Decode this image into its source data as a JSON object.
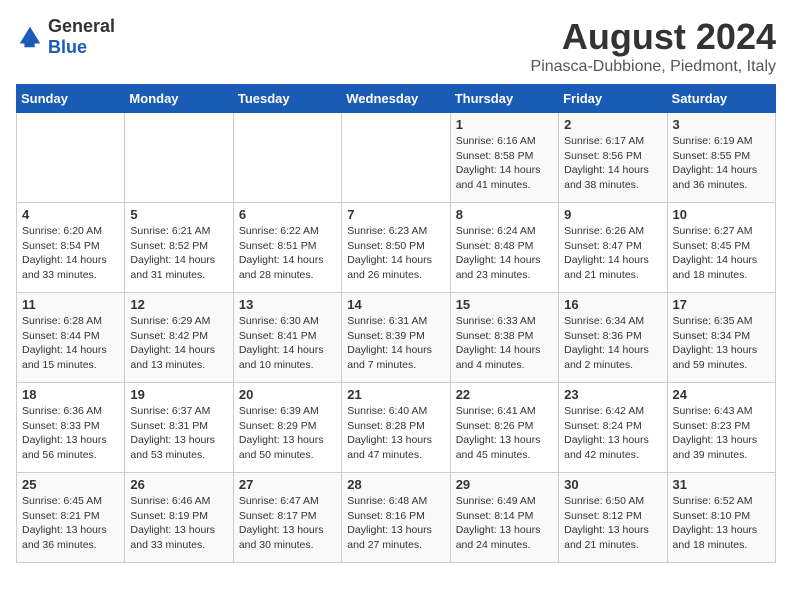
{
  "logo": {
    "general": "General",
    "blue": "Blue"
  },
  "title": "August 2024",
  "subtitle": "Pinasca-Dubbione, Piedmont, Italy",
  "days_of_week": [
    "Sunday",
    "Monday",
    "Tuesday",
    "Wednesday",
    "Thursday",
    "Friday",
    "Saturday"
  ],
  "weeks": [
    [
      {
        "day": "",
        "info": ""
      },
      {
        "day": "",
        "info": ""
      },
      {
        "day": "",
        "info": ""
      },
      {
        "day": "",
        "info": ""
      },
      {
        "day": "1",
        "info": "Sunrise: 6:16 AM\nSunset: 8:58 PM\nDaylight: 14 hours and 41 minutes."
      },
      {
        "day": "2",
        "info": "Sunrise: 6:17 AM\nSunset: 8:56 PM\nDaylight: 14 hours and 38 minutes."
      },
      {
        "day": "3",
        "info": "Sunrise: 6:19 AM\nSunset: 8:55 PM\nDaylight: 14 hours and 36 minutes."
      }
    ],
    [
      {
        "day": "4",
        "info": "Sunrise: 6:20 AM\nSunset: 8:54 PM\nDaylight: 14 hours and 33 minutes."
      },
      {
        "day": "5",
        "info": "Sunrise: 6:21 AM\nSunset: 8:52 PM\nDaylight: 14 hours and 31 minutes."
      },
      {
        "day": "6",
        "info": "Sunrise: 6:22 AM\nSunset: 8:51 PM\nDaylight: 14 hours and 28 minutes."
      },
      {
        "day": "7",
        "info": "Sunrise: 6:23 AM\nSunset: 8:50 PM\nDaylight: 14 hours and 26 minutes."
      },
      {
        "day": "8",
        "info": "Sunrise: 6:24 AM\nSunset: 8:48 PM\nDaylight: 14 hours and 23 minutes."
      },
      {
        "day": "9",
        "info": "Sunrise: 6:26 AM\nSunset: 8:47 PM\nDaylight: 14 hours and 21 minutes."
      },
      {
        "day": "10",
        "info": "Sunrise: 6:27 AM\nSunset: 8:45 PM\nDaylight: 14 hours and 18 minutes."
      }
    ],
    [
      {
        "day": "11",
        "info": "Sunrise: 6:28 AM\nSunset: 8:44 PM\nDaylight: 14 hours and 15 minutes."
      },
      {
        "day": "12",
        "info": "Sunrise: 6:29 AM\nSunset: 8:42 PM\nDaylight: 14 hours and 13 minutes."
      },
      {
        "day": "13",
        "info": "Sunrise: 6:30 AM\nSunset: 8:41 PM\nDaylight: 14 hours and 10 minutes."
      },
      {
        "day": "14",
        "info": "Sunrise: 6:31 AM\nSunset: 8:39 PM\nDaylight: 14 hours and 7 minutes."
      },
      {
        "day": "15",
        "info": "Sunrise: 6:33 AM\nSunset: 8:38 PM\nDaylight: 14 hours and 4 minutes."
      },
      {
        "day": "16",
        "info": "Sunrise: 6:34 AM\nSunset: 8:36 PM\nDaylight: 14 hours and 2 minutes."
      },
      {
        "day": "17",
        "info": "Sunrise: 6:35 AM\nSunset: 8:34 PM\nDaylight: 13 hours and 59 minutes."
      }
    ],
    [
      {
        "day": "18",
        "info": "Sunrise: 6:36 AM\nSunset: 8:33 PM\nDaylight: 13 hours and 56 minutes."
      },
      {
        "day": "19",
        "info": "Sunrise: 6:37 AM\nSunset: 8:31 PM\nDaylight: 13 hours and 53 minutes."
      },
      {
        "day": "20",
        "info": "Sunrise: 6:39 AM\nSunset: 8:29 PM\nDaylight: 13 hours and 50 minutes."
      },
      {
        "day": "21",
        "info": "Sunrise: 6:40 AM\nSunset: 8:28 PM\nDaylight: 13 hours and 47 minutes."
      },
      {
        "day": "22",
        "info": "Sunrise: 6:41 AM\nSunset: 8:26 PM\nDaylight: 13 hours and 45 minutes."
      },
      {
        "day": "23",
        "info": "Sunrise: 6:42 AM\nSunset: 8:24 PM\nDaylight: 13 hours and 42 minutes."
      },
      {
        "day": "24",
        "info": "Sunrise: 6:43 AM\nSunset: 8:23 PM\nDaylight: 13 hours and 39 minutes."
      }
    ],
    [
      {
        "day": "25",
        "info": "Sunrise: 6:45 AM\nSunset: 8:21 PM\nDaylight: 13 hours and 36 minutes."
      },
      {
        "day": "26",
        "info": "Sunrise: 6:46 AM\nSunset: 8:19 PM\nDaylight: 13 hours and 33 minutes."
      },
      {
        "day": "27",
        "info": "Sunrise: 6:47 AM\nSunset: 8:17 PM\nDaylight: 13 hours and 30 minutes."
      },
      {
        "day": "28",
        "info": "Sunrise: 6:48 AM\nSunset: 8:16 PM\nDaylight: 13 hours and 27 minutes."
      },
      {
        "day": "29",
        "info": "Sunrise: 6:49 AM\nSunset: 8:14 PM\nDaylight: 13 hours and 24 minutes."
      },
      {
        "day": "30",
        "info": "Sunrise: 6:50 AM\nSunset: 8:12 PM\nDaylight: 13 hours and 21 minutes."
      },
      {
        "day": "31",
        "info": "Sunrise: 6:52 AM\nSunset: 8:10 PM\nDaylight: 13 hours and 18 minutes."
      }
    ]
  ]
}
